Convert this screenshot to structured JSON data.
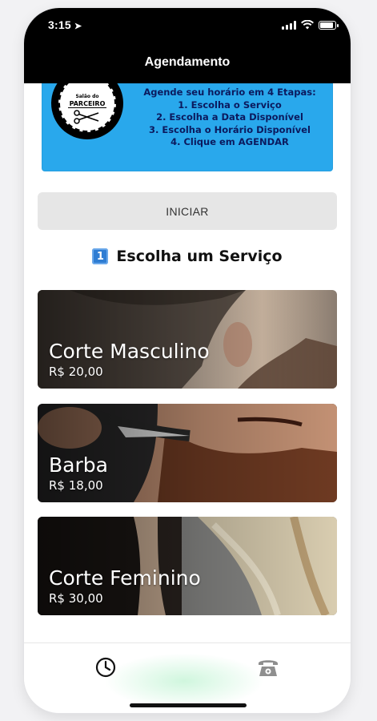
{
  "status_bar": {
    "time": "3:15"
  },
  "header": {
    "title": "Agendamento"
  },
  "banner": {
    "logo_top": "Salão do",
    "logo_name": "PARCEIRO",
    "lines": [
      "Agende seu horário em 4 Etapas:",
      "1. Escolha o Serviço",
      "2. Escolha a Data Disponível",
      "3. Escolha o Horário Disponível",
      "4. Clique em AGENDAR"
    ]
  },
  "start_button": {
    "label": "INICIAR"
  },
  "section": {
    "step_badge": "1",
    "title": "Escolha um Serviço"
  },
  "services": [
    {
      "name": "Corte Masculino",
      "price": "R$ 20,00"
    },
    {
      "name": "Barba",
      "price": "R$ 18,00"
    },
    {
      "name": "Corte Feminino",
      "price": "R$ 30,00"
    }
  ],
  "tabbar": {
    "items": [
      {
        "icon": "clock-icon"
      },
      {
        "icon": "telephone-icon"
      }
    ]
  },
  "colors": {
    "banner": "#29a8ec",
    "header": "#000000",
    "button": "#e6e6e6"
  }
}
